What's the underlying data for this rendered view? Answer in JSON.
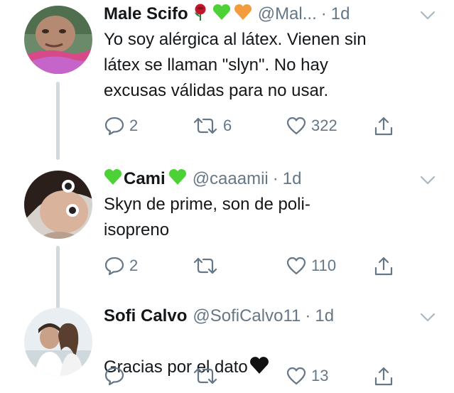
{
  "tweets": [
    {
      "name": "Male Scifo",
      "name_emojis": [
        "rose",
        "green-heart",
        "orange-heart"
      ],
      "handle": "@Mal...",
      "time": "1d",
      "text": "Yo soy alérgica al látex. Vienen sin\nlátex se llaman \"slyn\". No hay\nexcusas válidas para no usar.",
      "replies": "2",
      "retweets": "6",
      "likes": "322"
    },
    {
      "name": "Cami",
      "name_emojis": [
        "green-heart",
        "green-heart"
      ],
      "handle": "@caaamii",
      "time": "1d",
      "text": "Skyn de prime, son de poli-\nisopreno",
      "replies": "2",
      "retweets": "",
      "likes": "110"
    },
    {
      "name": "Sofi Calvo",
      "handle": "@SofiCalvo11",
      "time": "1d",
      "text": "Gracias por el dato",
      "text_emoji": "black-heart",
      "replies": "",
      "retweets": "",
      "likes": "13"
    }
  ],
  "separator": "·",
  "colors": {
    "text": "#14171a",
    "secondary": "#657786",
    "thread": "#cfd9de",
    "heart_green": "#4cd137",
    "heart_orange": "#f39c3d"
  }
}
